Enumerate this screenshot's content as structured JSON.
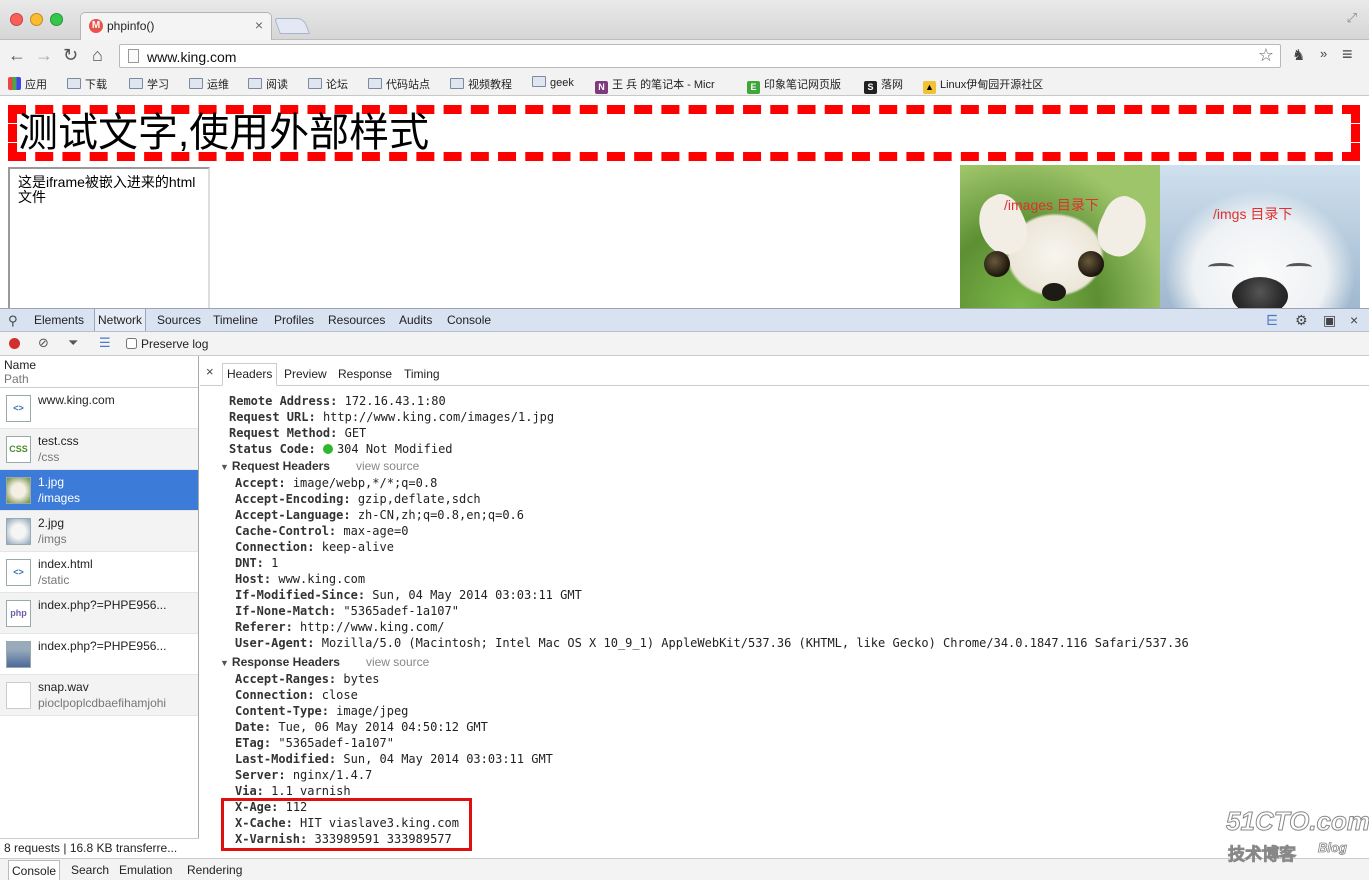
{
  "browser": {
    "tab_title": "phpinfo()",
    "url": "www.king.com",
    "bookmarks": [
      "应用",
      "下载",
      "学习",
      "运维",
      "阅读",
      "论坛",
      "代码站点",
      "视频教程",
      "geek",
      "王 兵 的笔记本 - Micr",
      "印象笔记网页版",
      "落网",
      "Linux伊甸园开源社区"
    ]
  },
  "page": {
    "heading": "测试文字,使用外部样式",
    "iframe_text": "这是iframe被嵌入进来的html文件",
    "image1_caption": "/images 目录下",
    "image2_caption": "/imgs 目录下"
  },
  "devtools": {
    "tabs": [
      "Elements",
      "Network",
      "Sources",
      "Timeline",
      "Profiles",
      "Resources",
      "Audits",
      "Console"
    ],
    "active_tab": "Network",
    "preserve_log": "Preserve log",
    "list_header": {
      "name": "Name",
      "path": "Path"
    },
    "requests": [
      {
        "name": "www.king.com",
        "path": "",
        "icon": "<>"
      },
      {
        "name": "test.css",
        "path": "/css",
        "icon": "CSS"
      },
      {
        "name": "1.jpg",
        "path": "/images",
        "icon": "img"
      },
      {
        "name": "2.jpg",
        "path": "/imgs",
        "icon": "img"
      },
      {
        "name": "index.html",
        "path": "/static",
        "icon": "<>"
      },
      {
        "name": "index.php?=PHPE956...",
        "path": "",
        "icon": "php"
      },
      {
        "name": "index.php?=PHPE956...",
        "path": "",
        "icon": "img"
      },
      {
        "name": "snap.wav",
        "path": "pioclpoplcdbaefihamjohi",
        "icon": ""
      }
    ],
    "status_bar": "8 requests | 16.8 KB transferre...",
    "detail_tabs": [
      "Headers",
      "Preview",
      "Response",
      "Timing"
    ],
    "general": [
      {
        "k": "Remote Address:",
        "v": "172.16.43.1:80"
      },
      {
        "k": "Request URL:",
        "v": "http://www.king.com/images/1.jpg"
      },
      {
        "k": "Request Method:",
        "v": "GET"
      },
      {
        "k": "Status Code:",
        "v": "304 Not Modified"
      }
    ],
    "request_headers_title": "Request Headers",
    "view_source": "view source",
    "request_headers": [
      {
        "k": "Accept:",
        "v": "image/webp,*/*;q=0.8"
      },
      {
        "k": "Accept-Encoding:",
        "v": "gzip,deflate,sdch"
      },
      {
        "k": "Accept-Language:",
        "v": "zh-CN,zh;q=0.8,en;q=0.6"
      },
      {
        "k": "Cache-Control:",
        "v": "max-age=0"
      },
      {
        "k": "Connection:",
        "v": "keep-alive"
      },
      {
        "k": "DNT:",
        "v": "1"
      },
      {
        "k": "Host:",
        "v": "www.king.com"
      },
      {
        "k": "If-Modified-Since:",
        "v": "Sun, 04 May 2014 03:03:11 GMT"
      },
      {
        "k": "If-None-Match:",
        "v": "\"5365adef-1a107\""
      },
      {
        "k": "Referer:",
        "v": "http://www.king.com/"
      },
      {
        "k": "User-Agent:",
        "v": "Mozilla/5.0 (Macintosh; Intel Mac OS X 10_9_1) AppleWebKit/537.36 (KHTML, like Gecko) Chrome/34.0.1847.116 Safari/537.36"
      }
    ],
    "response_headers_title": "Response Headers",
    "response_headers": [
      {
        "k": "Accept-Ranges:",
        "v": "bytes"
      },
      {
        "k": "Connection:",
        "v": "close"
      },
      {
        "k": "Content-Type:",
        "v": "image/jpeg"
      },
      {
        "k": "Date:",
        "v": "Tue, 06 May 2014 04:50:12 GMT"
      },
      {
        "k": "ETag:",
        "v": "\"5365adef-1a107\""
      },
      {
        "k": "Last-Modified:",
        "v": "Sun, 04 May 2014 03:03:11 GMT"
      },
      {
        "k": "Server:",
        "v": "nginx/1.4.7"
      },
      {
        "k": "Via:",
        "v": "1.1 varnish"
      },
      {
        "k": "X-Age:",
        "v": "112"
      },
      {
        "k": "X-Cache:",
        "v": "HIT viaslave3.king.com"
      },
      {
        "k": "X-Varnish:",
        "v": "333989591 333989577"
      }
    ],
    "drawer_tabs": [
      "Console",
      "Search",
      "Emulation",
      "Rendering"
    ]
  },
  "watermark": {
    "big": "51CTO.com",
    "small": "技术博客",
    "blog": "Blog"
  },
  "colors": {
    "dashed_border": "#ff0000",
    "selected_row": "#3d7bd9",
    "highlight_box": "#e01010"
  }
}
